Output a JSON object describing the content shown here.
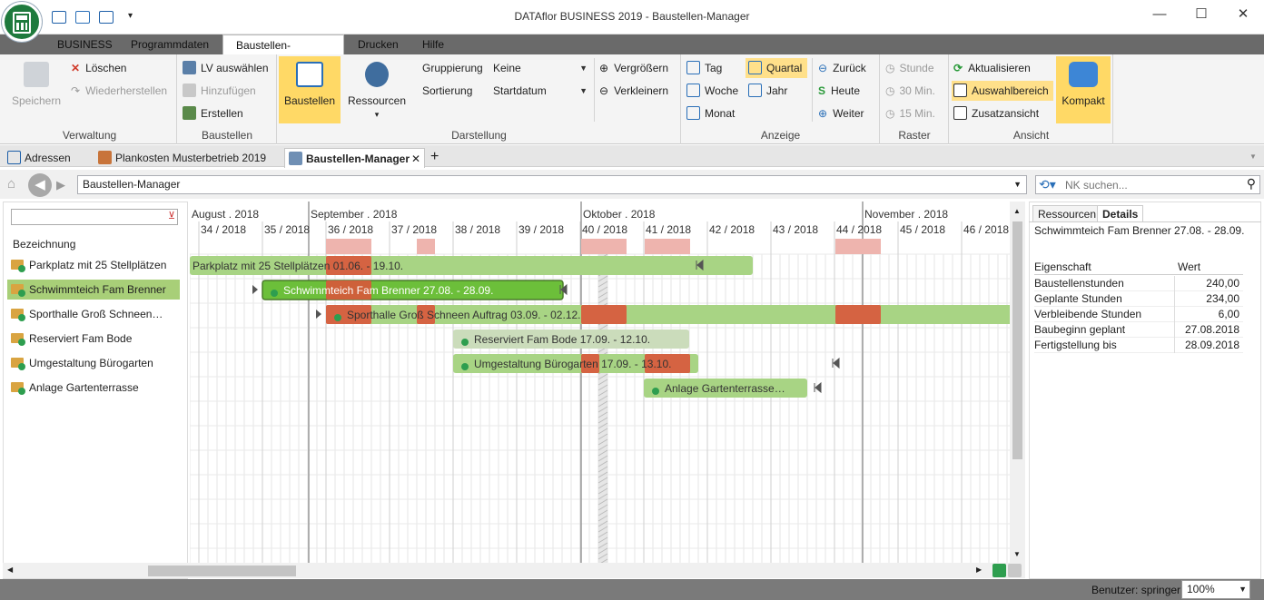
{
  "window": {
    "title": "DATAflor BUSINESS 2019 - Baustellen-Manager",
    "minimize": "—",
    "maximize": "☐",
    "close": "✕"
  },
  "menu": {
    "tabs": [
      "BUSINESS",
      "Programmdaten",
      "Baustellen-Manager",
      "Drucken",
      "Hilfe"
    ],
    "active": "Baustellen-Manager"
  },
  "ribbon": {
    "verwaltung": {
      "label": "Verwaltung",
      "save": "Speichern",
      "delete": "Löschen",
      "restore": "Wiederherstellen"
    },
    "baustellen": {
      "label": "Baustellen",
      "lv": "LV auswählen",
      "add": "Hinzufügen",
      "create": "Erstellen"
    },
    "darstellung": {
      "label": "Darstellung",
      "baustellen_btn": "Baustellen",
      "ressourcen_btn": "Ressourcen",
      "gruppierung_label": "Gruppierung",
      "gruppierung_value": "Keine",
      "sortierung_label": "Sortierung",
      "sortierung_value": "Startdatum",
      "zoom_in": "Vergrößern",
      "zoom_out": "Verkleinern"
    },
    "anzeige": {
      "label": "Anzeige",
      "tag": "Tag",
      "woche": "Woche",
      "monat": "Monat",
      "quartal": "Quartal",
      "jahr": "Jahr",
      "zurueck": "Zurück",
      "heute": "Heute",
      "weiter": "Weiter"
    },
    "raster": {
      "label": "Raster",
      "stunde": "Stunde",
      "m30": "30 Min.",
      "m15": "15 Min."
    },
    "ansicht": {
      "label": "Ansicht",
      "aktualisieren": "Aktualisieren",
      "auswahlbereich": "Auswahlbereich",
      "zusatzansicht": "Zusatzansicht",
      "kompakt": "Kompakt"
    }
  },
  "doc_tabs": {
    "t1": "Adressen",
    "t2": "Plankosten Musterbetrieb 2019",
    "t3": "Baustellen-Manager",
    "close": "✕",
    "add": "+"
  },
  "nav": {
    "breadcrumb": "Baustellen-Manager",
    "search_placeholder": "NK suchen..."
  },
  "left": {
    "header": "Bezeichnung",
    "rows": [
      "Parkplatz mit 25 Stellplätzen",
      "Schwimmteich Fam Brenner",
      "Sporthalle Groß Schneen…",
      "Reserviert Fam Bode",
      "Umgestaltung Bürogarten",
      "Anlage Gartenterrasse"
    ]
  },
  "gantt": {
    "months": [
      "August . 2018",
      "September . 2018",
      "Oktober . 2018",
      "November . 2018"
    ],
    "weeks": [
      "34 / 2018",
      "35 / 2018",
      "36 / 2018",
      "37 / 2018",
      "38 / 2018",
      "39 / 2018",
      "40 / 2018",
      "41 / 2018",
      "42 / 2018",
      "43 / 2018",
      "44 / 2018",
      "45 / 2018",
      "46 / 2018"
    ],
    "bars": [
      "Parkplatz mit 25 Stellplätzen 01.06. - 19.10.",
      "Schwimmteich Fam Brenner 27.08. - 28.09.",
      "Sporthalle Groß Schneen Auftrag 03.09. - 02.12.",
      "Reserviert Fam Bode 17.09. - 12.10.",
      "Umgestaltung Bürogarten 17.09. - 13.10.",
      "Anlage Gartenterrasse…"
    ]
  },
  "right": {
    "tabs": [
      "Ressourcen",
      "Details"
    ],
    "title": "Schwimmteich Fam Brenner 27.08. - 28.09.",
    "col_prop": "Eigenschaft",
    "col_val": "Wert",
    "props": [
      {
        "k": "Baustellenstunden",
        "v": "240,00"
      },
      {
        "k": "Geplante Stunden",
        "v": "234,00"
      },
      {
        "k": "Verbleibende Stunden",
        "v": "6,00"
      },
      {
        "k": "Baubeginn geplant",
        "v": "27.08.2018"
      },
      {
        "k": "Fertigstellung bis",
        "v": "28.09.2018"
      }
    ]
  },
  "status": {
    "user": "Benutzer: springer",
    "zoom": "100%"
  },
  "colors": {
    "bar_green": "#a8d484",
    "bar_selected": "#6cbf3a",
    "busy_red": "#d9573b",
    "busy_pink": "#eeb4ae",
    "accent_yellow": "#ffd966"
  }
}
